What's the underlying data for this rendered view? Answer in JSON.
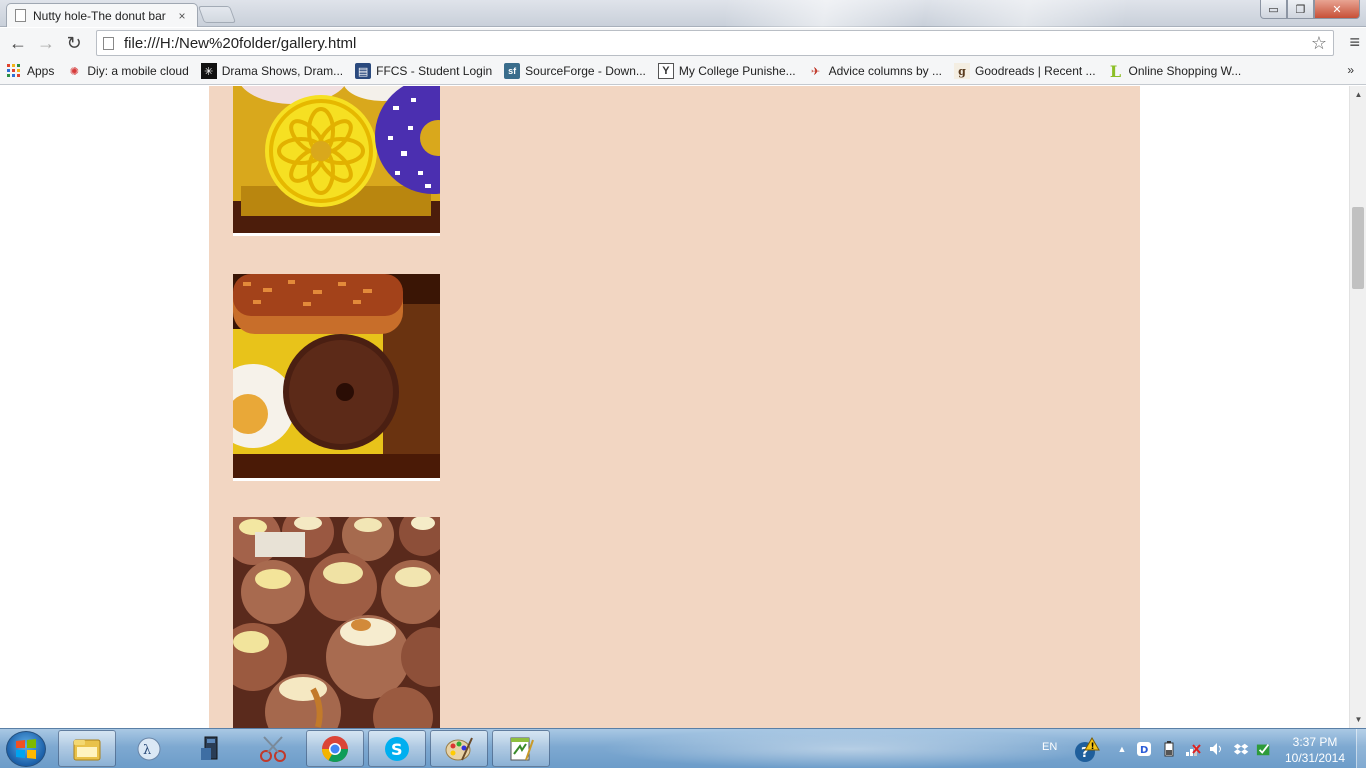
{
  "browser": {
    "tab": {
      "title": "Nutty hole-The donut bar",
      "close": "×"
    },
    "toolbar": {
      "back": "←",
      "forward": "→",
      "reload": "↻",
      "url": "file:///H:/New%20folder/gallery.html",
      "star": "☆",
      "menu": "≡"
    },
    "window_controls": {
      "minimize": "▭",
      "maximize": "❐",
      "close": "✕"
    },
    "bookmarks": [
      {
        "label": "Apps",
        "icon": "apps-grid-icon"
      },
      {
        "label": "Diy: a mobile cloud",
        "icon": "burst-icon"
      },
      {
        "label": "Drama Shows, Dram...",
        "icon": "drama-icon"
      },
      {
        "label": "FFCS - Student Login",
        "icon": "ffcs-icon"
      },
      {
        "label": "SourceForge - Down...",
        "icon": "sourceforge-icon"
      },
      {
        "label": "My College Punishe...",
        "icon": "ycombinator-icon"
      },
      {
        "label": "Advice columns by ...",
        "icon": "advice-icon"
      },
      {
        "label": "Goodreads | Recent ...",
        "icon": "goodreads-icon"
      },
      {
        "label": "Online Shopping W...",
        "icon": "shopping-icon"
      }
    ],
    "bookmarks_more": "»"
  },
  "gallery": {
    "background": "#f2d6c2",
    "photos": [
      {
        "subject": "box of glazed donuts"
      },
      {
        "subject": "bacon and chocolate donuts in box"
      },
      {
        "subject": "cream-topped sugar donuts"
      }
    ]
  },
  "taskbar": {
    "language": "EN",
    "time": "3:37 PM",
    "date": "10/31/2014",
    "apps": [
      "explorer",
      "math",
      "device-manager",
      "snipping-tool",
      "chrome",
      "skype",
      "paint",
      "notepad-plus"
    ]
  }
}
